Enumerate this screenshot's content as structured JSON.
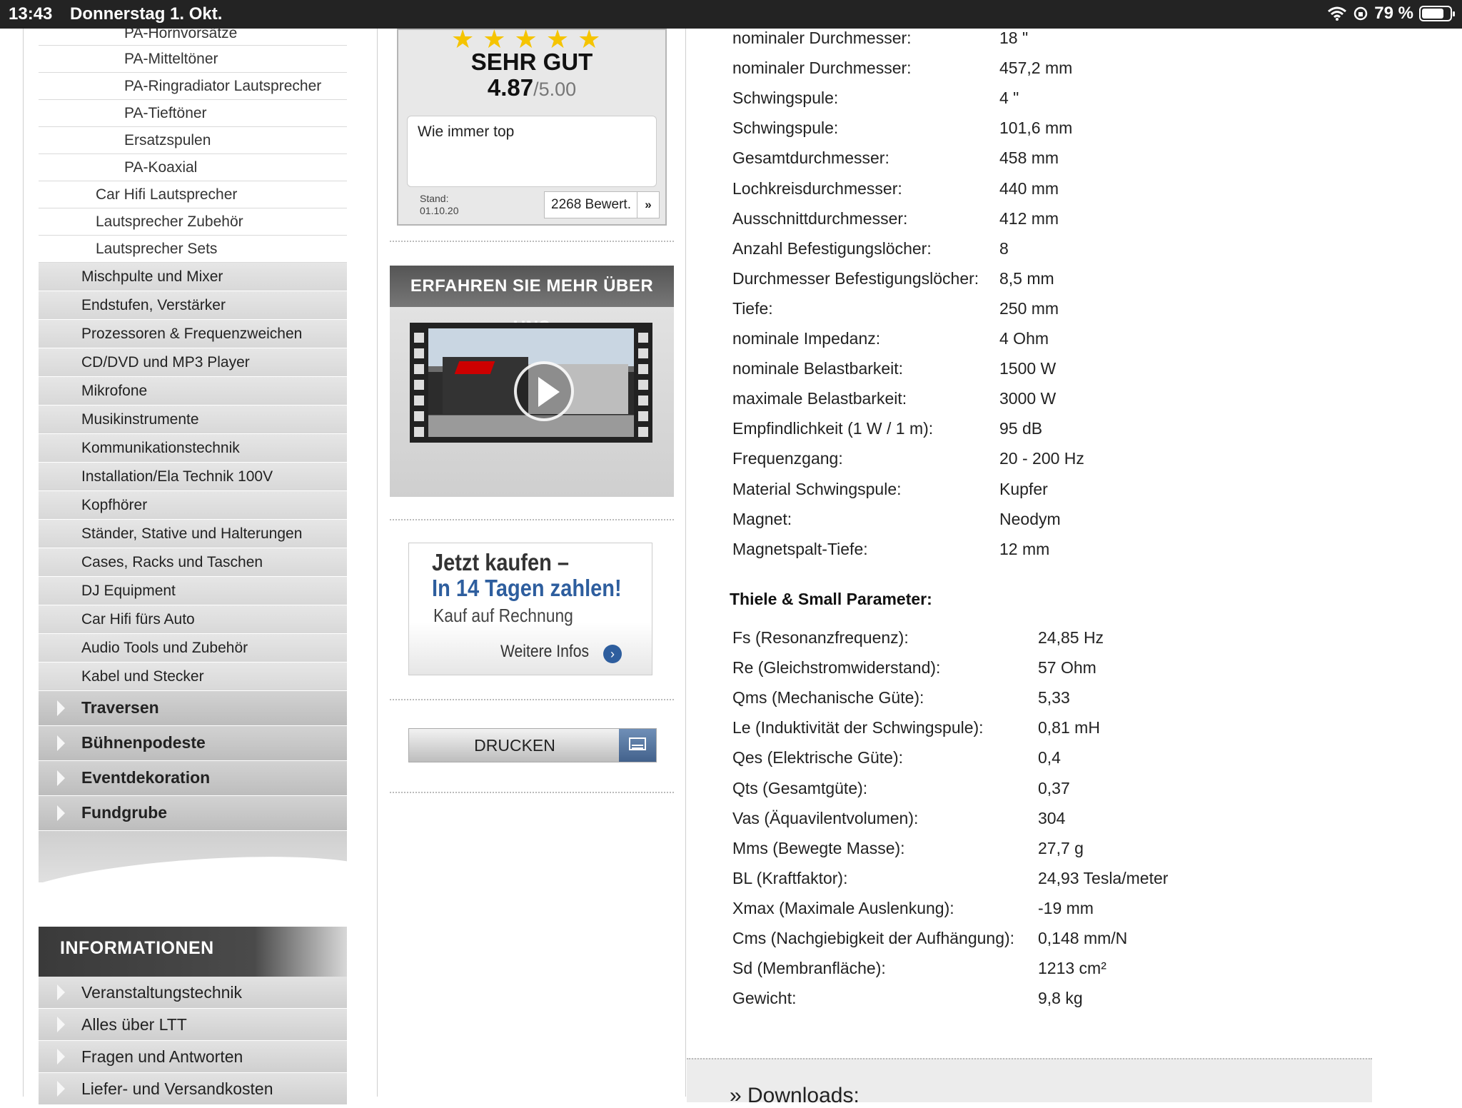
{
  "statusbar": {
    "time": "13:43",
    "date": "Donnerstag 1. Okt.",
    "battery": "79 %"
  },
  "sidebar": {
    "sub_items": [
      {
        "label": "PA-Hornvorsätze",
        "level": 3
      },
      {
        "label": "PA-Mitteltöner",
        "level": 3
      },
      {
        "label": "PA-Ringradiator Lautsprecher",
        "level": 3
      },
      {
        "label": "PA-Tieftöner",
        "level": 3
      },
      {
        "label": "Ersatzspulen",
        "level": 3
      },
      {
        "label": "PA-Koaxial",
        "level": 3
      },
      {
        "label": "Car Hifi Lautsprecher",
        "level": 2
      },
      {
        "label": "Lautsprecher Zubehör",
        "level": 2
      },
      {
        "label": "Lautsprecher Sets",
        "level": 2
      }
    ],
    "categories": [
      "Mischpulte und Mixer",
      "Endstufen, Verstärker",
      "Prozessoren & Frequenzweichen",
      "CD/DVD und MP3 Player",
      "Mikrofone",
      "Musikinstrumente",
      "Kommunikationstechnik",
      "Installation/Ela Technik 100V",
      "Kopfhörer",
      "Ständer, Stative und Halterungen",
      "Cases, Racks und Taschen",
      "DJ Equipment",
      "Car Hifi fürs Auto",
      "Audio Tools und Zubehör",
      "Kabel und Stecker"
    ],
    "main_categories": [
      "Traversen",
      "Bühnenpodeste",
      "Eventdekoration",
      "Fundgrube"
    ],
    "info_header": "INFORMATIONEN",
    "info_items": [
      "Veranstaltungstechnik",
      "Alles über LTT",
      "Fragen und Antworten",
      "Liefer- und Versandkosten"
    ]
  },
  "rating": {
    "stars": "★★★★★",
    "label": "SEHR GUT",
    "score": "4.87",
    "max": "/5.00",
    "comment": "Wie immer top",
    "stand_label": "Stand:",
    "stand_date": "01.10.20",
    "reviews": "2268 Bewert.",
    "reviews_arrow": "»"
  },
  "video": {
    "title": "ERFAHREN SIE MEHR ÜBER UNS"
  },
  "kauf": {
    "line1": "Jetzt kaufen –",
    "line2": "In 14 Tagen zahlen!",
    "line3": "Kauf auf Rechnung",
    "more": "Weitere Infos",
    "more_icon": "›"
  },
  "print": {
    "label": "DRUCKEN"
  },
  "specs": [
    {
      "k": "nominaler Durchmesser:",
      "v": "18 \""
    },
    {
      "k": "nominaler Durchmesser:",
      "v": "457,2 mm"
    },
    {
      "k": "Schwingspule:",
      "v": "4 \""
    },
    {
      "k": "Schwingspule:",
      "v": "101,6 mm"
    },
    {
      "k": "Gesamtdurchmesser:",
      "v": "458 mm"
    },
    {
      "k": "Lochkreisdurchmesser:",
      "v": "440 mm"
    },
    {
      "k": "Ausschnittdurchmesser:",
      "v": "412 mm"
    },
    {
      "k": "Anzahl Befestigungslöcher:",
      "v": "8"
    },
    {
      "k": "Durchmesser Befestigungslöcher:",
      "v": "8,5 mm"
    },
    {
      "k": "Tiefe:",
      "v": "250 mm"
    },
    {
      "k": "nominale Impedanz:",
      "v": "4 Ohm"
    },
    {
      "k": "nominale Belastbarkeit:",
      "v": "1500 W"
    },
    {
      "k": "maximale Belastbarkeit:",
      "v": "3000 W"
    },
    {
      "k": "Empfindlichkeit (1 W / 1 m):",
      "v": "95 dB"
    },
    {
      "k": "Frequenzgang:",
      "v": "20 - 200 Hz"
    },
    {
      "k": "Material Schwingspule:",
      "v": "Kupfer"
    },
    {
      "k": "Magnet:",
      "v": "Neodym"
    },
    {
      "k": "Magnetspalt-Tiefe:",
      "v": "12 mm"
    }
  ],
  "ts_title": "Thiele & Small Parameter:",
  "ts_params": [
    {
      "k": "Fs (Resonanzfrequenz):",
      "v": "24,85 Hz"
    },
    {
      "k": "Re (Gleichstromwiderstand):",
      "v": "57 Ohm"
    },
    {
      "k": "Qms (Mechanische Güte):",
      "v": "5,33"
    },
    {
      "k": "Le (Induktivität der Schwingspule):",
      "v": "0,81 mH"
    },
    {
      "k": "Qes (Elektrische Güte):",
      "v": "0,4"
    },
    {
      "k": "Qts (Gesamtgüte):",
      "v": "0,37"
    },
    {
      "k": "Vas (Äquavilentvolumen):",
      "v": "304"
    },
    {
      "k": "Mms (Bewegte Masse):",
      "v": "27,7 g"
    },
    {
      "k": "BL (Kraftfaktor):",
      "v": "24,93 Tesla/meter"
    },
    {
      "k": "Xmax (Maximale Auslenkung):",
      "v": "-19 mm"
    },
    {
      "k": "Cms (Nachgiebigkeit der Aufhängung):",
      "v": "0,148 mm/N"
    },
    {
      "k": "Sd (Membranfläche):",
      "v": "1213 cm²"
    },
    {
      "k": "Gewicht:",
      "v": "9,8 kg"
    }
  ],
  "downloads": "» Downloads:"
}
